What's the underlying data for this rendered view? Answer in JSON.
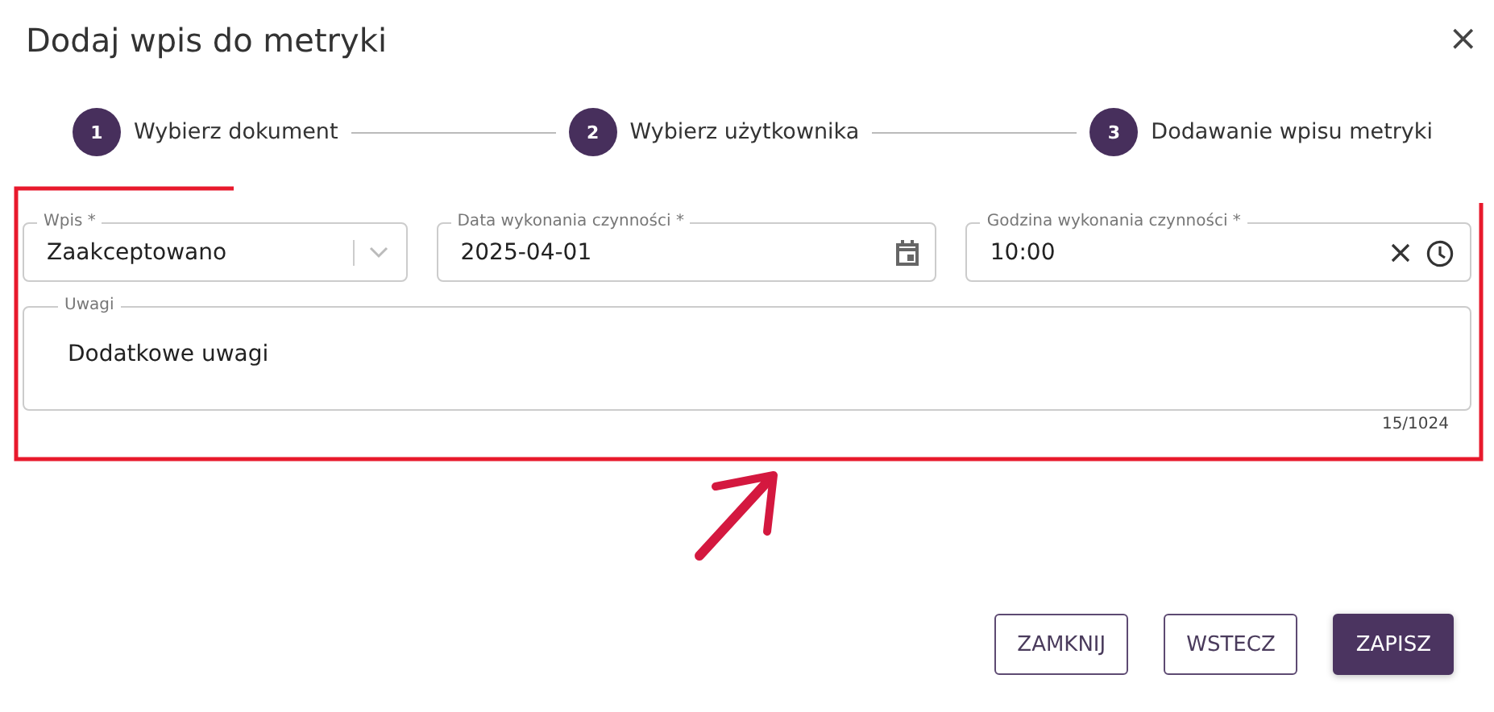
{
  "dialog": {
    "title": "Dodaj wpis do metryki",
    "close": "×"
  },
  "steps": [
    {
      "number": "1",
      "label": "Wybierz dokument"
    },
    {
      "number": "2",
      "label": "Wybierz użytkownika"
    },
    {
      "number": "3",
      "label": "Dodawanie wpisu metryki"
    }
  ],
  "fields": [
    {
      "kind": "select",
      "label": "Wpis *",
      "value": "Zaakceptowano"
    },
    {
      "kind": "date",
      "label": "Data wykonania czynności *",
      "value": "2025-04-01"
    },
    {
      "kind": "time",
      "label": "Godzina wykonania czynności *",
      "value": "10:00"
    }
  ],
  "notes": {
    "label": "Uwagi",
    "value": "Dodatkowe uwagi",
    "counter": "15/1024"
  },
  "buttons": [
    {
      "label": "ZAMKNIJ",
      "kind": "outline"
    },
    {
      "label": "WSTECZ",
      "kind": "outline"
    },
    {
      "label": "ZAPISZ",
      "kind": "primary"
    }
  ]
}
